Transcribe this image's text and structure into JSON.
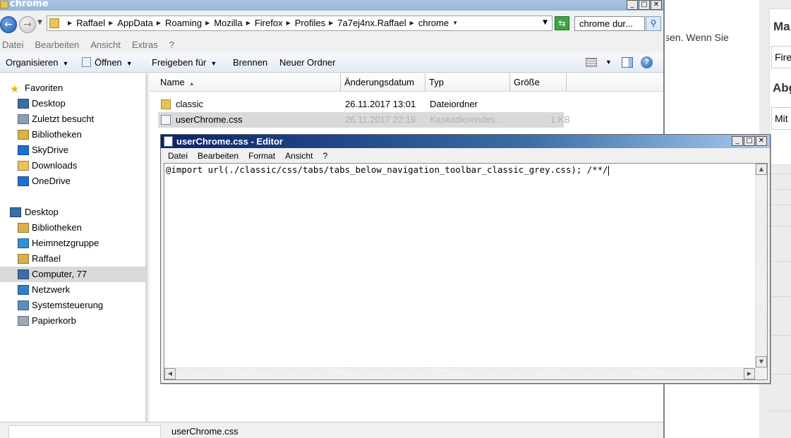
{
  "explorer": {
    "title": "chrome",
    "breadcrumbs": [
      "Raffael",
      "AppData",
      "Roaming",
      "Mozilla",
      "Firefox",
      "Profiles",
      "7a7ej4nx.Raffael",
      "chrome"
    ],
    "search_value": "chrome dur...",
    "menu": [
      "Datei",
      "Bearbeiten",
      "Ansicht",
      "Extras",
      "?"
    ],
    "commands": {
      "organize": "Organisieren",
      "open": "Öffnen",
      "share": "Freigeben für",
      "burn": "Brennen",
      "new_folder": "Neuer Ordner"
    },
    "columns": {
      "name": "Name",
      "date": "Änderungsdatum",
      "type": "Typ",
      "size": "Größe"
    },
    "files": [
      {
        "name": "classic",
        "date": "26.11.2017 13:01",
        "type": "Dateiordner",
        "size": "",
        "icon": "folder-icon"
      },
      {
        "name": "userChrome.css",
        "date": "26.11.2017 22:19",
        "type": "Kaskadierendes...",
        "size": "1 KB",
        "icon": "css-file-icon"
      }
    ],
    "nav": {
      "favorites_header": "Favoriten",
      "favorites": [
        "Desktop",
        "Zuletzt besucht",
        "Bibliotheken",
        "SkyDrive",
        "Downloads",
        "OneDrive"
      ],
      "desktop_header": "Desktop",
      "desktop_items": [
        "Bibliotheken",
        "Heimnetzgruppe",
        "Raffael",
        "Computer, 77",
        "Netzwerk",
        "Systemsteuerung",
        "Papierkorb"
      ]
    },
    "status_text": "userChrome.css"
  },
  "notepad": {
    "title": "userChrome.css - Editor",
    "menu": [
      "Datei",
      "Bearbeiten",
      "Format",
      "Ansicht",
      "?"
    ],
    "content": "@import url(./classic/css/tabs/tabs_below_navigation_toolbar_classic_grey.css); /**/"
  },
  "background_page": {
    "text_fragment": "sen. Wenn Sie",
    "heading1": "Ma",
    "input1": "Fire",
    "heading2": "Abg",
    "input2": "Mit"
  },
  "colors": {
    "selection": "#d9d9d9",
    "notepad_title_start": "#0a246a",
    "notepad_title_end": "#a6caf0"
  }
}
